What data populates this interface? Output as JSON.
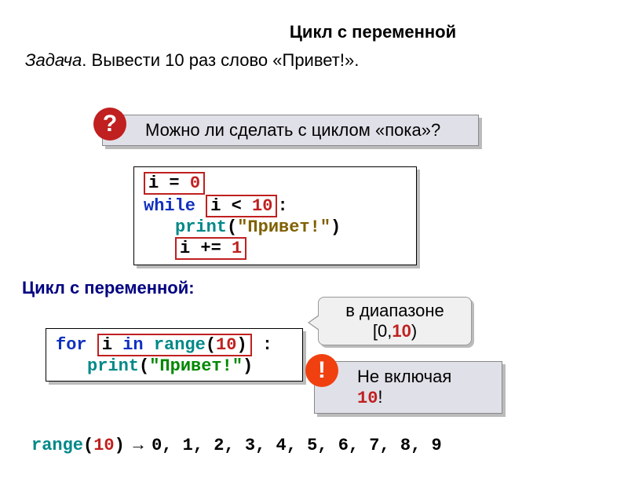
{
  "title": "Цикл с переменной",
  "problem_label": "Задача",
  "problem_text": ". Вывести 10 раз слово «Привет!».",
  "callout_q": "Можно ли сделать с циклом «пока»?",
  "badge_q": "?",
  "badge_e": "!",
  "code1": {
    "line1_pre": "i = ",
    "line1_num": "0",
    "line2_kw": "while",
    "line2_cond_pre": " i < ",
    "line2_cond_num": "10",
    "line2_colon": ":",
    "line3_fn": "print",
    "line3_paren_open": "(",
    "line3_str": "\"Привет!\"",
    "line3_paren_close": ")",
    "line4_pre": "i += ",
    "line4_num": "1"
  },
  "section2": "Цикл с переменной:",
  "code2": {
    "kw_for": "for",
    "var_i": " i ",
    "kw_in": "in",
    "fn_range": " range",
    "paren_open": "(",
    "num_10": "10",
    "paren_close": ")",
    "colon": " :",
    "print_fn": "print",
    "p_open": "(",
    "str_hello": "\"Привет!\"",
    "p_close": ")"
  },
  "speech": {
    "line1": "в диапазоне",
    "line2_open": "[0,",
    "line2_num": "10",
    "line2_close": ")"
  },
  "callout_e": {
    "text": " Не включая ",
    "num": "10",
    "excl": "!"
  },
  "range_line": {
    "fn": "range",
    "open": "(",
    "num": "10",
    "close": ")",
    "arrow": " → ",
    "seq": "0, 1, 2, 3, 4, 5, 6, 7, 8, 9"
  }
}
